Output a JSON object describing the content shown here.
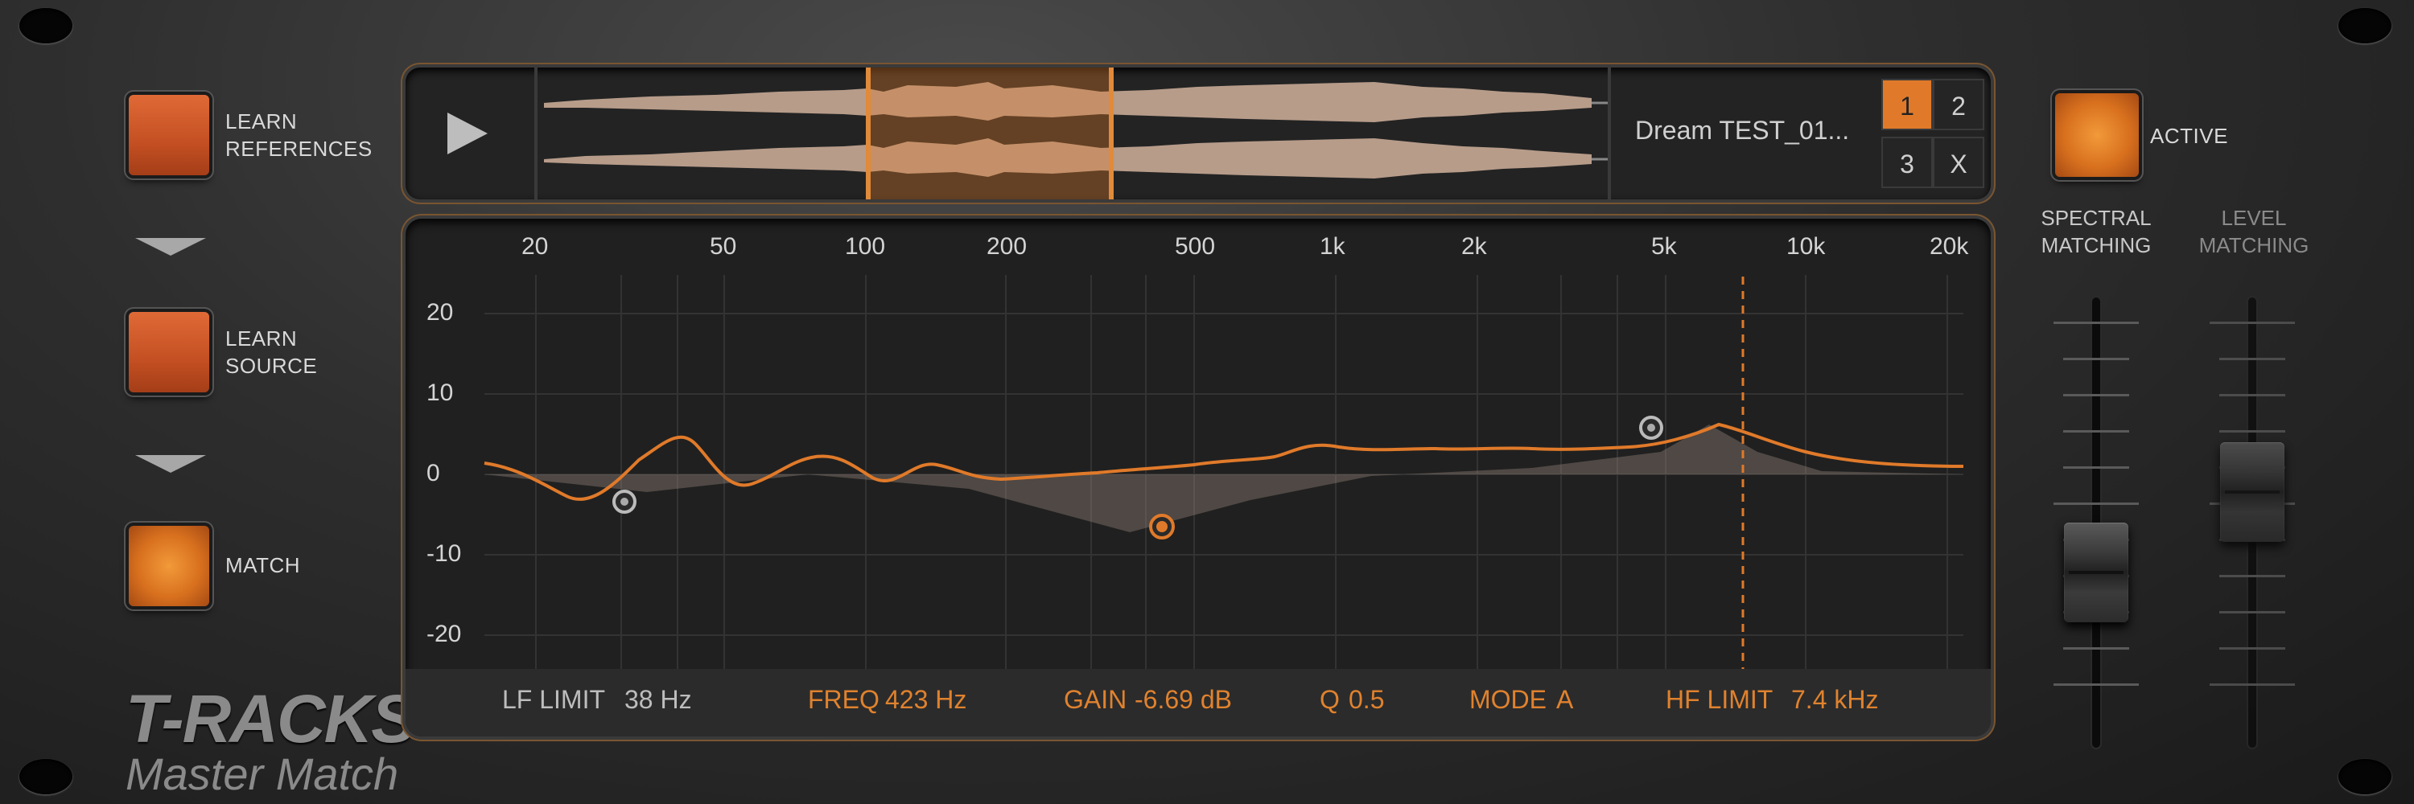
{
  "app": {
    "logo_main": "T-RACKS",
    "logo_sub": "Master Match"
  },
  "left_controls": {
    "learn_references": "LEARN\nREFERENCES",
    "learn_source": "LEARN\nSOURCE",
    "match": "MATCH"
  },
  "reference": {
    "name": "Dream TEST_01...",
    "slots": [
      "1",
      "2",
      "3",
      "X"
    ],
    "active_slot": "1"
  },
  "eq": {
    "freq_labels": [
      "20",
      "50",
      "100",
      "200",
      "500",
      "1k",
      "2k",
      "5k",
      "10k",
      "20k"
    ],
    "db_labels": [
      "20",
      "10",
      "0",
      "-10",
      "-20"
    ],
    "footer": {
      "lf_limit_label": "LF LIMIT",
      "lf_limit_value": "38 Hz",
      "freq_label": "FREQ",
      "freq_value": "423 Hz",
      "gain_label": "GAIN",
      "gain_value": "-6.69 dB",
      "q_label": "Q",
      "q_value": "0.5",
      "mode_label": "MODE",
      "mode_value": "A",
      "hf_limit_label": "HF LIMIT",
      "hf_limit_value": "7.4 kHz"
    }
  },
  "right_controls": {
    "active_label": "ACTIVE",
    "spectral_label": "SPECTRAL\nMATCHING",
    "level_label": "LEVEL\nMATCHING"
  },
  "colors": {
    "accent_orange": "#e0822e",
    "button_orange": "#d05a28",
    "panel_bg": "#202020"
  }
}
